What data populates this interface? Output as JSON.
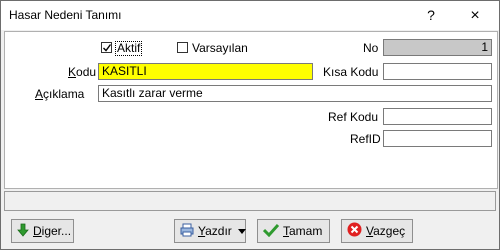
{
  "window": {
    "title": "Hasar Nedeni Tanımı",
    "help_glyph": "?",
    "close_glyph": "×"
  },
  "form": {
    "aktif_label": "Aktif",
    "aktif_checked": true,
    "varsayilan_label": "Varsayılan",
    "varsayilan_checked": false,
    "no_label": "No",
    "no_value": "1",
    "kodu_label": "Kodu",
    "kodu_value": "KASITLI",
    "kisa_kodu_label": "Kısa Kodu",
    "kisa_kodu_value": "",
    "aciklama_label": "Açıklama",
    "aciklama_value": "Kasıtlı zarar verme",
    "ref_kodu_label": "Ref Kodu",
    "ref_kodu_value": "",
    "refid_label": "RefID",
    "refid_value": ""
  },
  "buttons": {
    "diger": "Diger...",
    "yazdir": "Yazdır",
    "tamam": "Tamam",
    "vazgec": "Vazgeç"
  },
  "colors": {
    "highlight": "#ffff00",
    "readonly": "#c8c8c8"
  },
  "icons": [
    "arrow-down-icon",
    "printer-icon",
    "checkmark-icon",
    "cancel-icon",
    "dropdown-arrow-icon"
  ]
}
